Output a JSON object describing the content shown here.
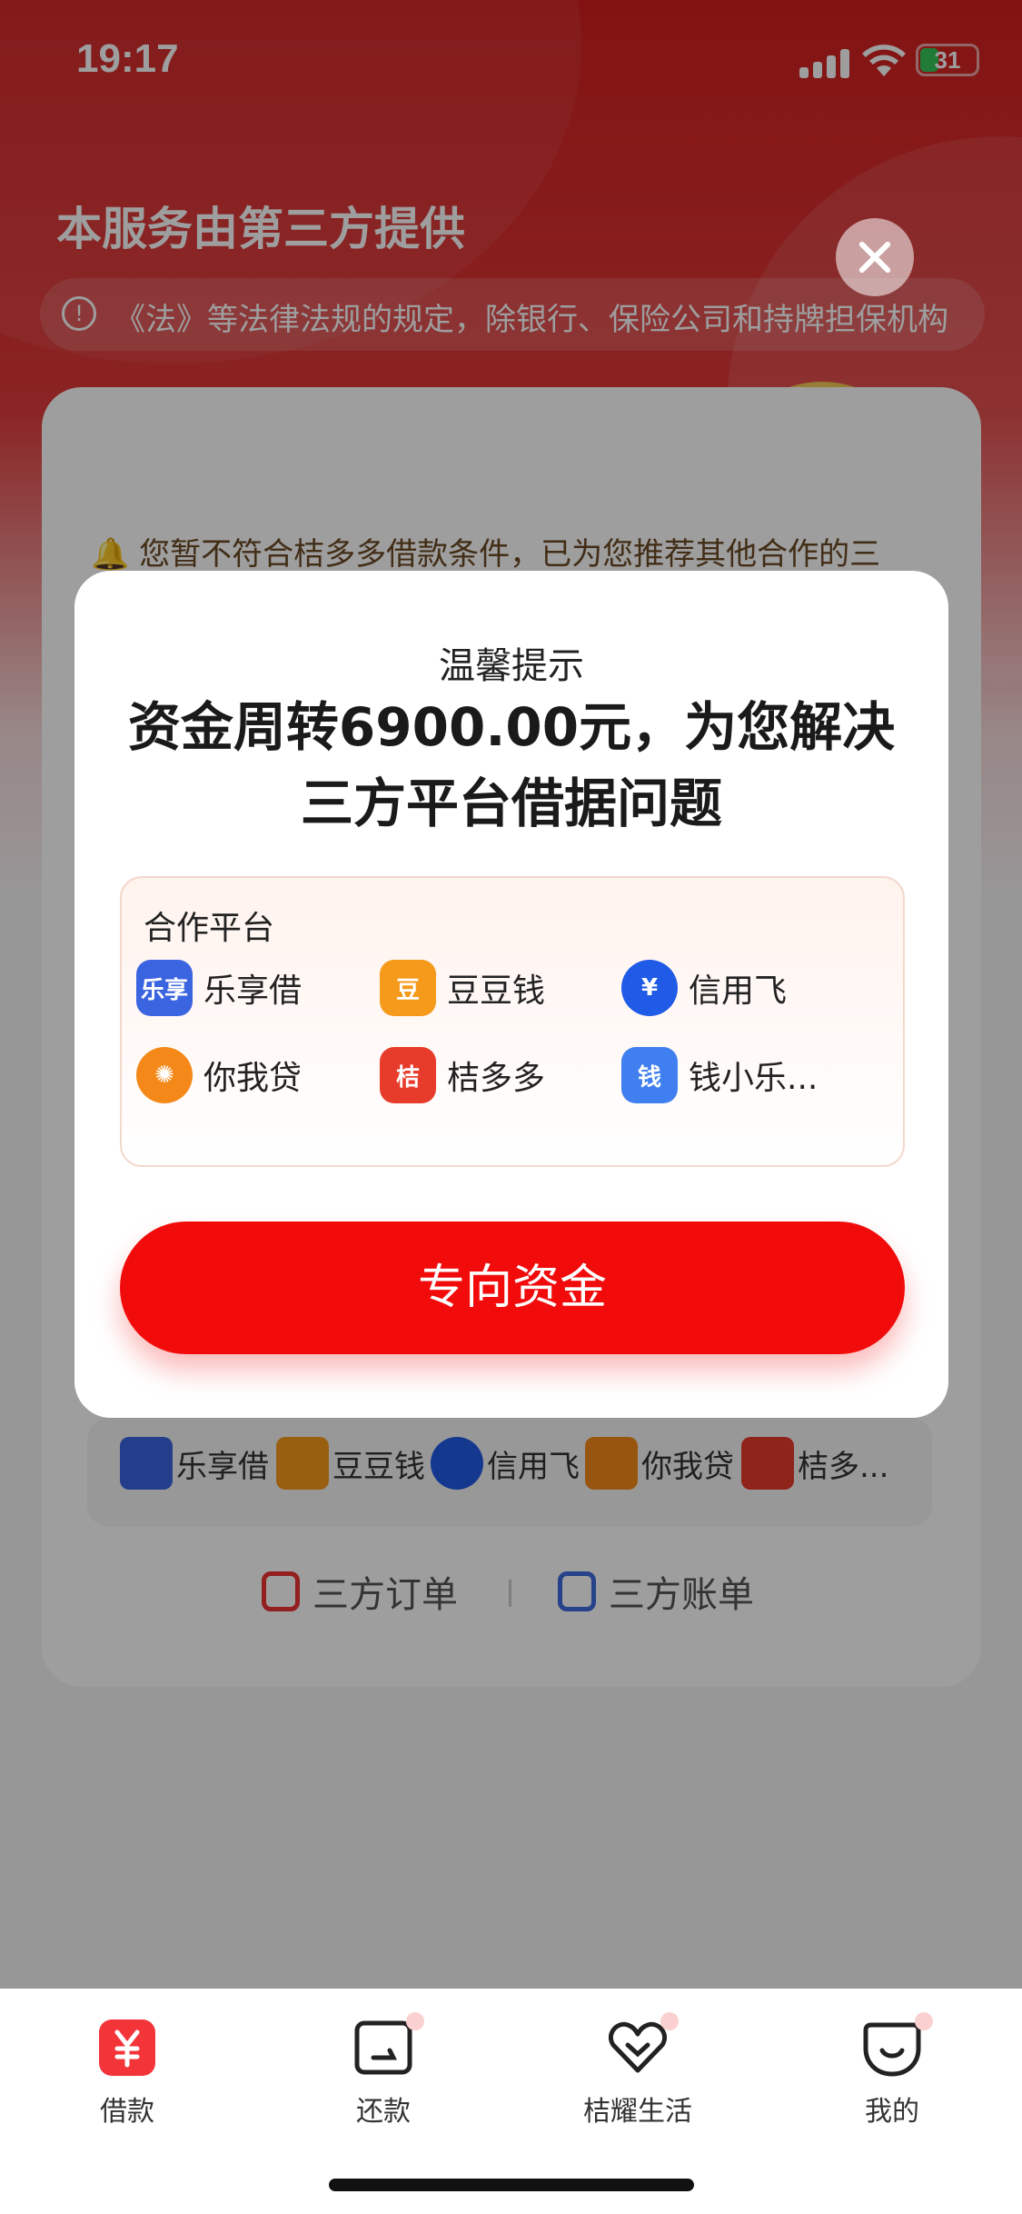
{
  "status_bar": {
    "time": "19:17",
    "battery": "31"
  },
  "background": {
    "title": "本服务由第三方提供",
    "notice": "《法》等法律法规的规定，除银行、保险公司和持牌担保机构",
    "card_notice": "🔔 您暂不符合桔多多借款条件，已为您推荐其他合作的三",
    "platform_strip": [
      {
        "name": "乐享借",
        "color": "#3b64e0"
      },
      {
        "name": "豆豆钱",
        "color": "#f59a1b"
      },
      {
        "name": "信用飞",
        "color": "#1f5be6"
      },
      {
        "name": "你我贷",
        "color": "#f4891a"
      },
      {
        "name": "桔多...",
        "color": "#e73b2b"
      }
    ],
    "links": {
      "orders": "三方订单",
      "bills": "三方账单"
    }
  },
  "modal": {
    "subtitle": "温馨提示",
    "title": "资金周转6900.00元，为您解决三方平台借据问题",
    "partner_heading": "合作平台",
    "partners": [
      {
        "name": "乐享借",
        "logo_text": "乐享",
        "color": "#3b64e0"
      },
      {
        "name": "豆豆钱",
        "logo_text": "豆",
        "color": "#f59a1b"
      },
      {
        "name": "信用飞",
        "logo_text": "¥",
        "color": "#1f5be6"
      },
      {
        "name": "你我贷",
        "logo_text": "✺",
        "color": "#f4891a"
      },
      {
        "name": "桔多多",
        "logo_text": "桔",
        "color": "#e73b2b"
      },
      {
        "name": "钱小乐...",
        "logo_text": "钱",
        "color": "#3f7fef"
      }
    ],
    "cta_label": "专向资金"
  },
  "tabbar": {
    "items": [
      {
        "label": "借款",
        "icon": "yuan-icon",
        "active": true
      },
      {
        "label": "还款",
        "icon": "card-icon"
      },
      {
        "label": "桔耀生活",
        "icon": "heart-icon"
      },
      {
        "label": "我的",
        "icon": "smile-icon"
      }
    ]
  },
  "colors": {
    "brand_red": "#f10b0b",
    "header_red": "#d31f1f"
  }
}
